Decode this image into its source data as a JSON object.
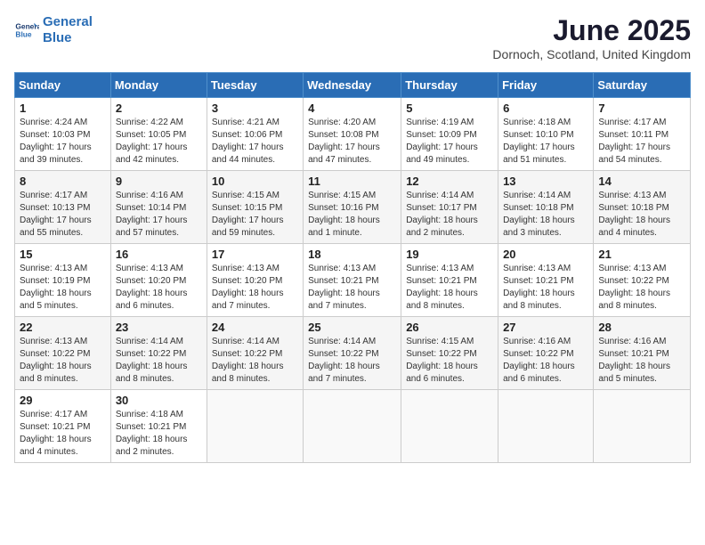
{
  "logo": {
    "line1": "General",
    "line2": "Blue"
  },
  "title": "June 2025",
  "subtitle": "Dornoch, Scotland, United Kingdom",
  "days_of_week": [
    "Sunday",
    "Monday",
    "Tuesday",
    "Wednesday",
    "Thursday",
    "Friday",
    "Saturday"
  ],
  "weeks": [
    [
      {
        "day": 1,
        "info": "Sunrise: 4:24 AM\nSunset: 10:03 PM\nDaylight: 17 hours\nand 39 minutes."
      },
      {
        "day": 2,
        "info": "Sunrise: 4:22 AM\nSunset: 10:05 PM\nDaylight: 17 hours\nand 42 minutes."
      },
      {
        "day": 3,
        "info": "Sunrise: 4:21 AM\nSunset: 10:06 PM\nDaylight: 17 hours\nand 44 minutes."
      },
      {
        "day": 4,
        "info": "Sunrise: 4:20 AM\nSunset: 10:08 PM\nDaylight: 17 hours\nand 47 minutes."
      },
      {
        "day": 5,
        "info": "Sunrise: 4:19 AM\nSunset: 10:09 PM\nDaylight: 17 hours\nand 49 minutes."
      },
      {
        "day": 6,
        "info": "Sunrise: 4:18 AM\nSunset: 10:10 PM\nDaylight: 17 hours\nand 51 minutes."
      },
      {
        "day": 7,
        "info": "Sunrise: 4:17 AM\nSunset: 10:11 PM\nDaylight: 17 hours\nand 54 minutes."
      }
    ],
    [
      {
        "day": 8,
        "info": "Sunrise: 4:17 AM\nSunset: 10:13 PM\nDaylight: 17 hours\nand 55 minutes."
      },
      {
        "day": 9,
        "info": "Sunrise: 4:16 AM\nSunset: 10:14 PM\nDaylight: 17 hours\nand 57 minutes."
      },
      {
        "day": 10,
        "info": "Sunrise: 4:15 AM\nSunset: 10:15 PM\nDaylight: 17 hours\nand 59 minutes."
      },
      {
        "day": 11,
        "info": "Sunrise: 4:15 AM\nSunset: 10:16 PM\nDaylight: 18 hours\nand 1 minute."
      },
      {
        "day": 12,
        "info": "Sunrise: 4:14 AM\nSunset: 10:17 PM\nDaylight: 18 hours\nand 2 minutes."
      },
      {
        "day": 13,
        "info": "Sunrise: 4:14 AM\nSunset: 10:18 PM\nDaylight: 18 hours\nand 3 minutes."
      },
      {
        "day": 14,
        "info": "Sunrise: 4:13 AM\nSunset: 10:18 PM\nDaylight: 18 hours\nand 4 minutes."
      }
    ],
    [
      {
        "day": 15,
        "info": "Sunrise: 4:13 AM\nSunset: 10:19 PM\nDaylight: 18 hours\nand 5 minutes."
      },
      {
        "day": 16,
        "info": "Sunrise: 4:13 AM\nSunset: 10:20 PM\nDaylight: 18 hours\nand 6 minutes."
      },
      {
        "day": 17,
        "info": "Sunrise: 4:13 AM\nSunset: 10:20 PM\nDaylight: 18 hours\nand 7 minutes."
      },
      {
        "day": 18,
        "info": "Sunrise: 4:13 AM\nSunset: 10:21 PM\nDaylight: 18 hours\nand 7 minutes."
      },
      {
        "day": 19,
        "info": "Sunrise: 4:13 AM\nSunset: 10:21 PM\nDaylight: 18 hours\nand 8 minutes."
      },
      {
        "day": 20,
        "info": "Sunrise: 4:13 AM\nSunset: 10:21 PM\nDaylight: 18 hours\nand 8 minutes."
      },
      {
        "day": 21,
        "info": "Sunrise: 4:13 AM\nSunset: 10:22 PM\nDaylight: 18 hours\nand 8 minutes."
      }
    ],
    [
      {
        "day": 22,
        "info": "Sunrise: 4:13 AM\nSunset: 10:22 PM\nDaylight: 18 hours\nand 8 minutes."
      },
      {
        "day": 23,
        "info": "Sunrise: 4:14 AM\nSunset: 10:22 PM\nDaylight: 18 hours\nand 8 minutes."
      },
      {
        "day": 24,
        "info": "Sunrise: 4:14 AM\nSunset: 10:22 PM\nDaylight: 18 hours\nand 8 minutes."
      },
      {
        "day": 25,
        "info": "Sunrise: 4:14 AM\nSunset: 10:22 PM\nDaylight: 18 hours\nand 7 minutes."
      },
      {
        "day": 26,
        "info": "Sunrise: 4:15 AM\nSunset: 10:22 PM\nDaylight: 18 hours\nand 6 minutes."
      },
      {
        "day": 27,
        "info": "Sunrise: 4:16 AM\nSunset: 10:22 PM\nDaylight: 18 hours\nand 6 minutes."
      },
      {
        "day": 28,
        "info": "Sunrise: 4:16 AM\nSunset: 10:21 PM\nDaylight: 18 hours\nand 5 minutes."
      }
    ],
    [
      {
        "day": 29,
        "info": "Sunrise: 4:17 AM\nSunset: 10:21 PM\nDaylight: 18 hours\nand 4 minutes."
      },
      {
        "day": 30,
        "info": "Sunrise: 4:18 AM\nSunset: 10:21 PM\nDaylight: 18 hours\nand 2 minutes."
      },
      null,
      null,
      null,
      null,
      null
    ]
  ]
}
